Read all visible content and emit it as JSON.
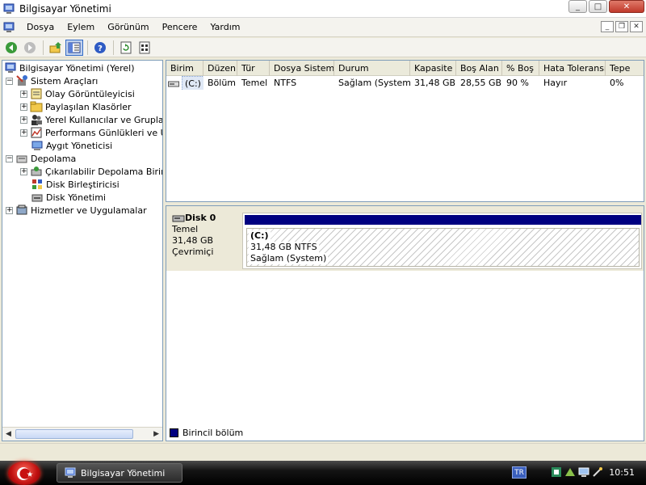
{
  "window": {
    "title": "Bilgisayar Yönetimi",
    "buttons": {
      "minimize": "_",
      "maximize": "□",
      "close": "✕"
    }
  },
  "menubar": {
    "items": [
      "Dosya",
      "Eylem",
      "Görünüm",
      "Pencere",
      "Yardım"
    ],
    "mdi": {
      "minimize": "_",
      "restore": "❐",
      "close": "✕"
    }
  },
  "toolbar": {
    "buttons": [
      "back-icon",
      "forward-icon",
      "up-folder-icon",
      "show-hide-tree-icon",
      "help-icon",
      "refresh-icon",
      "properties-icon"
    ]
  },
  "tree": {
    "items": [
      {
        "label": "Bilgisayar Yönetimi (Yerel)",
        "icon": "computer-management-icon",
        "expander": ""
      },
      {
        "label": "Sistem Araçları",
        "icon": "system-tools-icon",
        "expander": "−"
      },
      {
        "label": "Olay Görüntüleyicisi",
        "icon": "event-viewer-icon",
        "expander": "+"
      },
      {
        "label": "Paylaşılan Klasörler",
        "icon": "shared-folders-icon",
        "expander": "+"
      },
      {
        "label": "Yerel Kullanıcılar ve Gruplar",
        "icon": "local-users-icon",
        "expander": "+"
      },
      {
        "label": "Performans Günlükleri ve Uy",
        "icon": "performance-logs-icon",
        "expander": "+"
      },
      {
        "label": "Aygıt Yöneticisi",
        "icon": "device-manager-icon",
        "expander": ""
      },
      {
        "label": "Depolama",
        "icon": "storage-icon",
        "expander": "−"
      },
      {
        "label": "Çıkarılabilir Depolama Birimi",
        "icon": "removable-storage-icon",
        "expander": "+"
      },
      {
        "label": "Disk Birleştiricisi",
        "icon": "defragmenter-icon",
        "expander": ""
      },
      {
        "label": "Disk Yönetimi",
        "icon": "disk-management-icon",
        "expander": ""
      },
      {
        "label": "Hizmetler ve Uygulamalar",
        "icon": "services-icon",
        "expander": "+"
      }
    ],
    "scroll": {
      "left": "◀",
      "right": "▶"
    }
  },
  "volume_list": {
    "columns": [
      "Birim",
      "Düzen",
      "Tür",
      "Dosya Sistemi",
      "Durum",
      "Kapasite",
      "Boş Alan",
      "% Boş",
      "Hata Toleransı",
      "Tepe"
    ],
    "rows": [
      [
        "(C:)",
        "Bölüm",
        "Temel",
        "NTFS",
        "Sağlam (System)",
        "31,48 GB",
        "28,55 GB",
        "90 %",
        "Hayır",
        "0%"
      ]
    ]
  },
  "disk": {
    "name": "Disk 0",
    "type": "Temel",
    "size": "31,48 GB",
    "status": "Çevrimiçi",
    "partition": {
      "volume": "(C:)",
      "size_fs": "31,48 GB NTFS",
      "status": "Sağlam (System)"
    }
  },
  "legend": {
    "label": "Birincil bölüm",
    "color": "#000080"
  },
  "taskbar": {
    "task_label": "Bilgisayar Yönetimi",
    "language": "TR",
    "clock": "10:51"
  }
}
